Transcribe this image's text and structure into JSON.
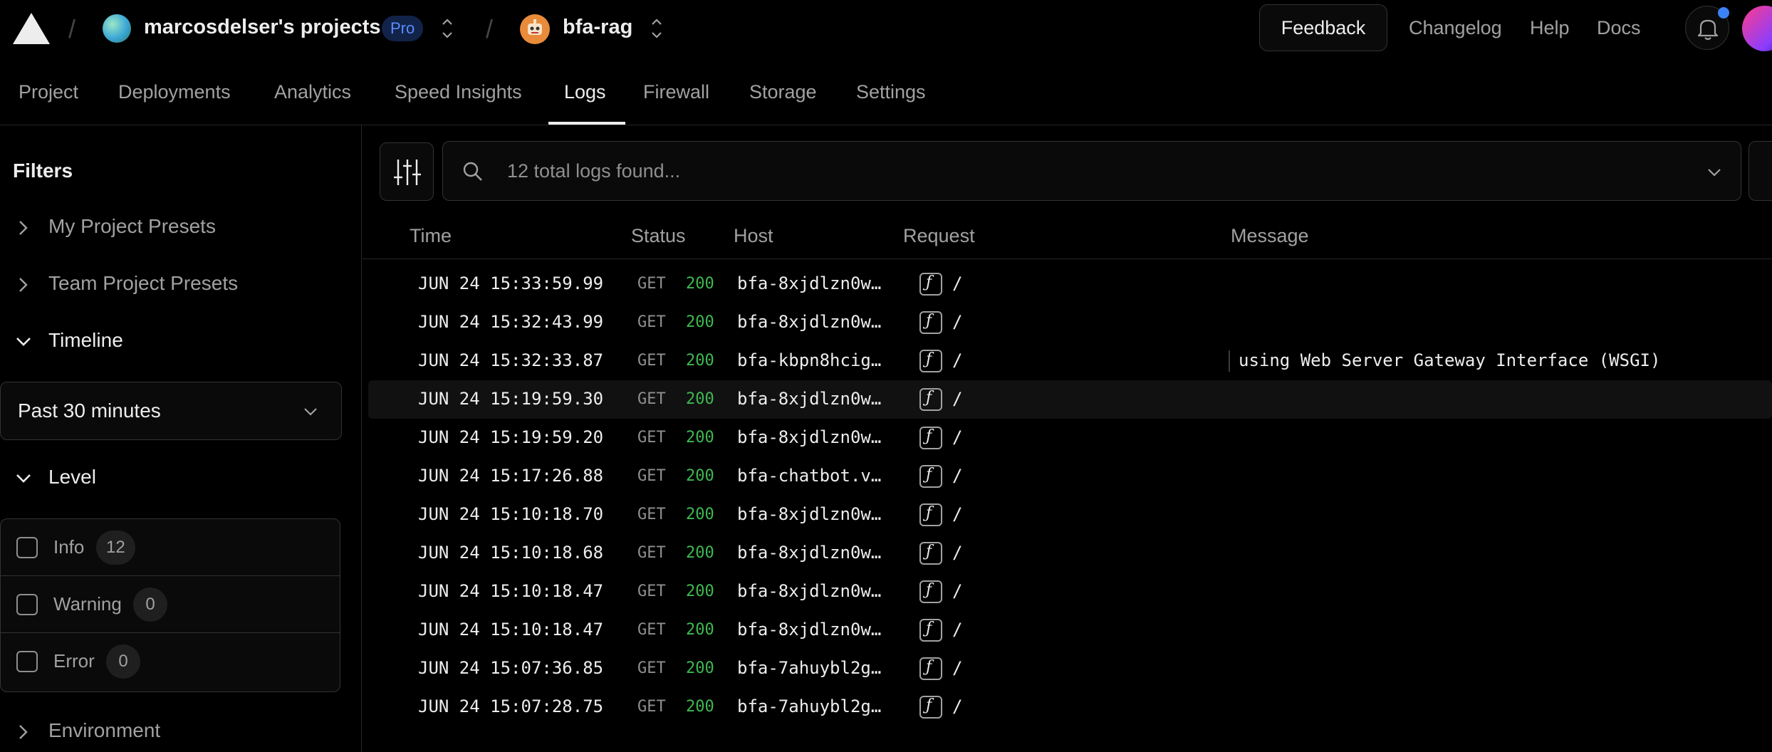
{
  "topbar": {
    "team_name": "marcosdelser's projects",
    "plan_badge": "Pro",
    "project_name": "bfa-rag",
    "feedback_label": "Feedback",
    "links": [
      "Changelog",
      "Help",
      "Docs"
    ]
  },
  "tabs": [
    "Project",
    "Deployments",
    "Analytics",
    "Speed Insights",
    "Logs",
    "Firewall",
    "Storage",
    "Settings"
  ],
  "active_tab": "Logs",
  "sidebar": {
    "title": "Filters",
    "sections": [
      "My Project Presets",
      "Team Project Presets",
      "Timeline",
      "Level",
      "Environment"
    ],
    "time_range": "Past 30 minutes",
    "levels": [
      {
        "name": "Info",
        "count": "12"
      },
      {
        "name": "Warning",
        "count": "0"
      },
      {
        "name": "Error",
        "count": "0"
      }
    ]
  },
  "search": {
    "placeholder": "12 total logs found..."
  },
  "table": {
    "columns": [
      "Time",
      "Status",
      "Host",
      "Request",
      "Message"
    ],
    "rows": [
      {
        "time": "JUN 24 15:33:59.99",
        "method": "GET",
        "status": "200",
        "host": "bfa-8xjdlzn0w…",
        "path": "/",
        "message": ""
      },
      {
        "time": "JUN 24 15:32:43.99",
        "method": "GET",
        "status": "200",
        "host": "bfa-8xjdlzn0w…",
        "path": "/",
        "message": ""
      },
      {
        "time": "JUN 24 15:32:33.87",
        "method": "GET",
        "status": "200",
        "host": "bfa-kbpn8hcig…",
        "path": "/",
        "message": "using Web Server Gateway Interface (WSGI)"
      },
      {
        "time": "JUN 24 15:19:59.30",
        "method": "GET",
        "status": "200",
        "host": "bfa-8xjdlzn0w…",
        "path": "/",
        "message": ""
      },
      {
        "time": "JUN 24 15:19:59.20",
        "method": "GET",
        "status": "200",
        "host": "bfa-8xjdlzn0w…",
        "path": "/",
        "message": ""
      },
      {
        "time": "JUN 24 15:17:26.88",
        "method": "GET",
        "status": "200",
        "host": "bfa-chatbot.v…",
        "path": "/",
        "message": ""
      },
      {
        "time": "JUN 24 15:10:18.70",
        "method": "GET",
        "status": "200",
        "host": "bfa-8xjdlzn0w…",
        "path": "/",
        "message": ""
      },
      {
        "time": "JUN 24 15:10:18.68",
        "method": "GET",
        "status": "200",
        "host": "bfa-8xjdlzn0w…",
        "path": "/",
        "message": ""
      },
      {
        "time": "JUN 24 15:10:18.47",
        "method": "GET",
        "status": "200",
        "host": "bfa-8xjdlzn0w…",
        "path": "/",
        "message": ""
      },
      {
        "time": "JUN 24 15:10:18.47",
        "method": "GET",
        "status": "200",
        "host": "bfa-8xjdlzn0w…",
        "path": "/",
        "message": ""
      },
      {
        "time": "JUN 24 15:07:36.85",
        "method": "GET",
        "status": "200",
        "host": "bfa-7ahuybl2g…",
        "path": "/",
        "message": ""
      },
      {
        "time": "JUN 24 15:07:28.75",
        "method": "GET",
        "status": "200",
        "host": "bfa-7ahuybl2g…",
        "path": "/",
        "message": ""
      }
    ]
  },
  "colors": {
    "background": "#000000",
    "status_ok": "#3fb950",
    "pro_badge": "#5b8cff",
    "notification_dot": "#3b82f6"
  },
  "icons": [
    "vercel-logo-icon",
    "chevron-updown-icon",
    "bell-icon",
    "chevron-right-icon",
    "chevron-down-icon",
    "sliders-icon",
    "search-icon",
    "function-icon"
  ]
}
